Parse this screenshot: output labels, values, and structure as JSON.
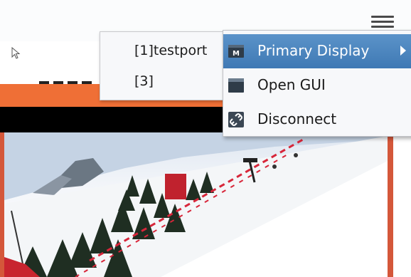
{
  "context_menu": {
    "ports": [
      {
        "label": "[1]testport"
      },
      {
        "label": "[3]"
      }
    ],
    "items": [
      {
        "label": "Primary Display",
        "icon": "monitor-icon",
        "icon_text": "M",
        "selected": true,
        "has_submenu": true
      },
      {
        "label": "Open GUI",
        "icon": "window-icon"
      },
      {
        "label": "Disconnect",
        "icon": "broken-link-icon"
      }
    ]
  },
  "colors": {
    "selection": "#4a84bf",
    "orange_band": "#ef6f36",
    "frame_border": "#d4573a"
  }
}
